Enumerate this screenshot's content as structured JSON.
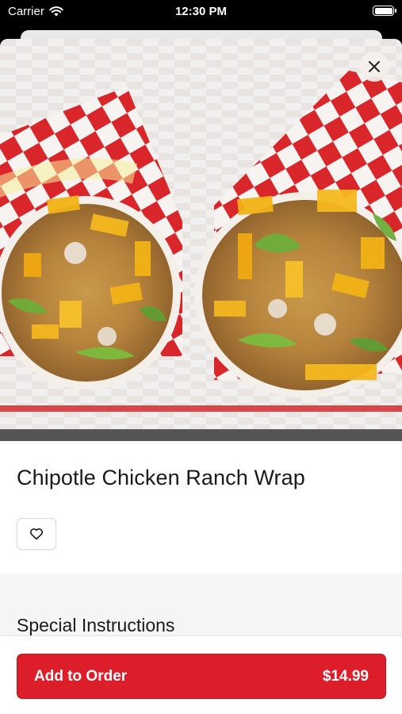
{
  "status_bar": {
    "carrier": "Carrier",
    "time": "12:30 PM"
  },
  "item": {
    "name": "Chipotle Chicken Ranch Wrap"
  },
  "sections": {
    "special_instructions": "Special Instructions"
  },
  "cta": {
    "label": "Add to Order",
    "price": "$14.99"
  },
  "colors": {
    "brand_red": "#dc1e2b"
  },
  "icons": {
    "close": "close-icon",
    "favorite": "heart-icon",
    "wifi": "wifi-icon"
  }
}
